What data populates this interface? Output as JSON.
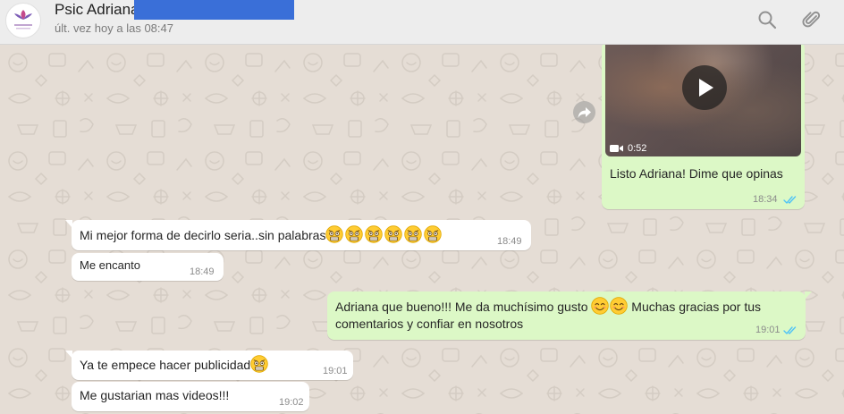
{
  "header": {
    "contact_name": "Psic Adriana",
    "last_seen": "últ. vez hoy a las 08:47",
    "icons": [
      "search-icon",
      "attach-icon"
    ]
  },
  "messages": [
    {
      "direction": "outgoing",
      "type": "video",
      "duration": "0:52",
      "text": "Listo Adriana! Dime que opinas",
      "time": "18:34",
      "status": "read"
    },
    {
      "direction": "incoming",
      "text": "Mi mejor forma de decirlo seria..sin palabras",
      "emoji": "astonished-face-x6",
      "time": "18:49"
    },
    {
      "direction": "incoming",
      "text": "Me encanto",
      "time": "18:49"
    },
    {
      "direction": "outgoing",
      "text_line1": "Adriana que bueno!!! Me da muchísimo gusto",
      "emoji": "smiling-face-x2",
      "text_line1b": "Muchas gracias por tus",
      "text_line2": "comentarios y confiar en nosotros",
      "time": "19:01",
      "status": "read"
    },
    {
      "direction": "incoming",
      "text": "Ya te empece hacer publicidad",
      "emoji": "astonished-face",
      "time": "19:01"
    },
    {
      "direction": "incoming",
      "text": "Me gustarian mas videos!!!",
      "time": "19:02"
    }
  ],
  "colors": {
    "header_bg": "#ededed",
    "chat_bg": "#e5ddd5",
    "incoming_bubble": "#ffffff",
    "outgoing_bubble": "#dcf8c6",
    "read_ticks": "#4fc3f7",
    "redaction": "#3a6fd8"
  }
}
